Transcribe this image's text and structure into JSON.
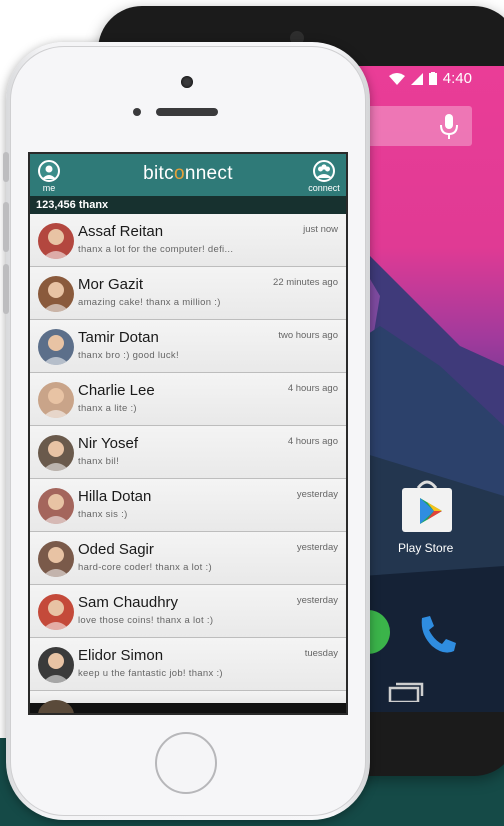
{
  "app": {
    "logo_left": "bitc",
    "logo_o": "o",
    "logo_right": "nnect",
    "me_label": "me",
    "connect_label": "connect",
    "balance": "123,456 thanx"
  },
  "contacts": [
    {
      "name": "Assaf Reitan",
      "message": "thanx a lot for the computer! defi...",
      "time": "just now",
      "avatar_color": "#b3473f"
    },
    {
      "name": "Mor Gazit",
      "message": "amazing cake! thanx a million :)",
      "time": "22 minutes ago",
      "avatar_color": "#8a5a3c"
    },
    {
      "name": "Tamir Dotan",
      "message": "thanx bro :) good luck!",
      "time": "two hours ago",
      "avatar_color": "#5c6f8a"
    },
    {
      "name": "Charlie Lee",
      "message": "thanx a lite :)",
      "time": "4 hours ago",
      "avatar_color": "#c9a489"
    },
    {
      "name": "Nir Yosef",
      "message": "thanx bil!",
      "time": "4 hours ago",
      "avatar_color": "#6a5a4c"
    },
    {
      "name": "Hilla Dotan",
      "message": "thanx sis :)",
      "time": "yesterday",
      "avatar_color": "#a4655c"
    },
    {
      "name": "Oded Sagir",
      "message": "hard-core coder! thanx a lot :)",
      "time": "yesterday",
      "avatar_color": "#7a5a4a"
    },
    {
      "name": "Sam Chaudhry",
      "message": "love those coins! thanx a lot :)",
      "time": "yesterday",
      "avatar_color": "#c44a3a"
    },
    {
      "name": "Elidor Simon",
      "message": "keep u the fantastic job! thanx :)",
      "time": "tuesday",
      "avatar_color": "#3a3a3a"
    }
  ],
  "android": {
    "time": "4:40",
    "play_store_label": "Play Store"
  },
  "colors": {
    "header": "#2f7a78",
    "balance_bar": "#17312f",
    "logo_accent": "#e6a03a",
    "bottom_band": "#154a47"
  }
}
